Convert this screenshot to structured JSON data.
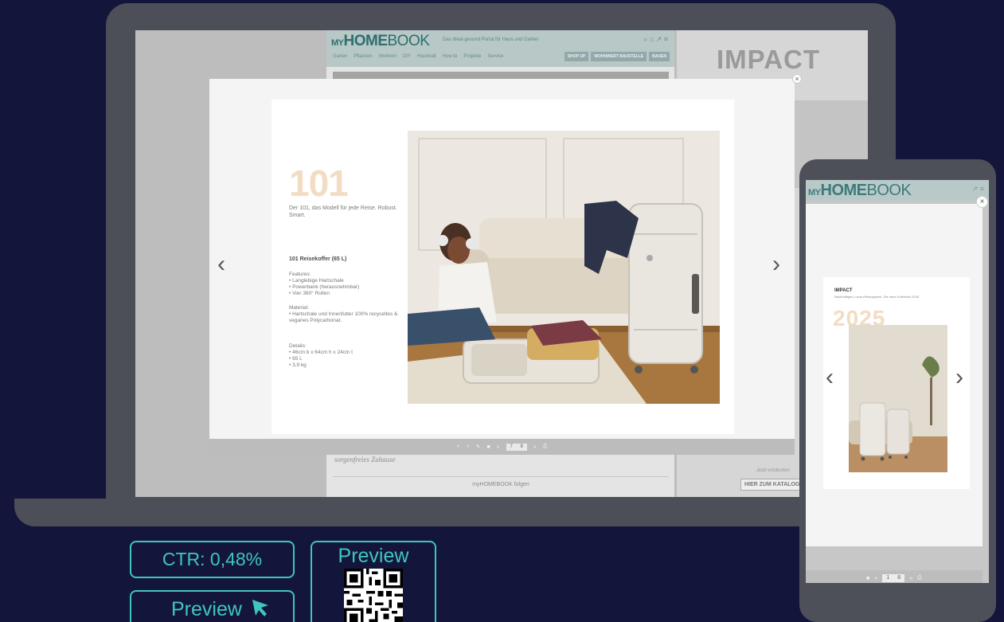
{
  "site": {
    "logo_my": "MY",
    "logo_home": "HOME",
    "logo_book": "BOOK",
    "tagline": "Das Ideal-gesund Portal für Haus und Garten",
    "head_icons": "⌕ ⌂ ↗ ≡",
    "nav": [
      "Garten",
      "Pflanzen",
      "Wohnen",
      "DIY",
      "Haushalt",
      "How to",
      "Projekte",
      "Service"
    ],
    "buttons": [
      "SHOP UP",
      "WOHNWERT BAUSTELLE",
      "BAUEN"
    ],
    "footer_text": "sorgenfreies Zuhause",
    "follow": "myHOMEBOOK folgen"
  },
  "side_panel": {
    "impact_title": "IMPACT",
    "katalog_note": "Jetzt entdecken",
    "katalog_button": "HIER ZUM KATALOG"
  },
  "lightbox": {
    "close": "×",
    "prev": "‹",
    "next": "›",
    "toolbar_icons": [
      "⌕",
      "⌕",
      "✎",
      "■",
      "«"
    ],
    "page_current": "7",
    "page_total": "8",
    "toolbar_after": [
      "»",
      "⎙"
    ]
  },
  "catalog_page": {
    "number": "101",
    "subtitle": "Der 101, das Modell für jede Reise. Robust. Smart.",
    "product_title": "101 Reisekoffer (65 L)",
    "features_title": "Features:",
    "features": [
      "Langlebige Hartschale",
      "Powerbank (herausnehmbar)",
      "Vier 360° Rollen"
    ],
    "material_title": "Material:",
    "material": [
      "Hartschale und Innenfutter 100% recyceltes & veganes Polycarbonat."
    ],
    "details_title": "Details:",
    "details": [
      "46cm b x 64cm h x 24cm t",
      "65 L",
      "3,9 kg"
    ]
  },
  "phone": {
    "logo_my": "MY",
    "logo_home": "HOME",
    "logo_book": "BOOK",
    "head_icons": "↗ ≡",
    "close": "×",
    "prev": "‹",
    "next": "›",
    "impact": "IMPACT",
    "impact_sub": "Nachhaltiges Luxus-Reisegepäck. Die neue Kollektion 2025",
    "year": "2025",
    "page_current": "1",
    "page_total": "8",
    "toolbar_left": [
      "■",
      "«"
    ],
    "toolbar_right": [
      "»",
      "⎙"
    ]
  },
  "stats": {
    "ctr": "CTR: 0,48%",
    "preview_button": "Preview",
    "preview_qr_label": "Preview"
  },
  "colors": {
    "accent": "#3ec5c2",
    "background": "#13163a",
    "device": "#4c4f58"
  }
}
